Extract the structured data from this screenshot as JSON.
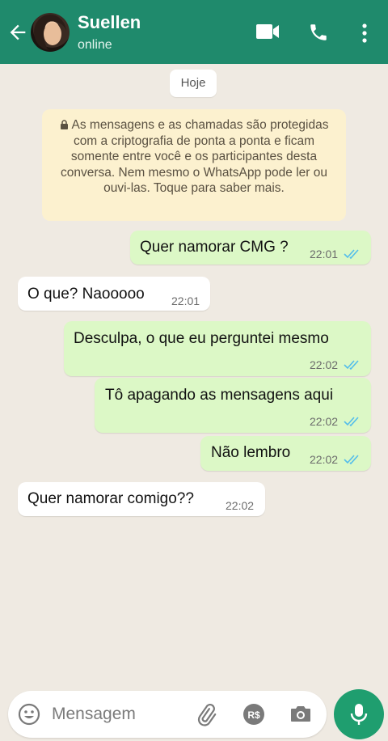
{
  "header": {
    "contact_name": "Suellen",
    "status": "online",
    "icons": [
      "back-arrow-icon",
      "video-call-icon",
      "phone-icon",
      "more-options-icon"
    ],
    "color": "#1f8a6c"
  },
  "chat": {
    "date_label": "Hoje",
    "encryption_notice": "As mensagens e as chamadas são protegidas com a criptografia de ponta a ponta e ficam somente entre você e os participantes desta conversa. Nem mesmo o WhatsApp pode ler ou ouvi-las. Toque para saber mais.",
    "messages": [
      {
        "direction": "out",
        "text": "Quer namorar CMG ?",
        "time": "22:01",
        "read": true
      },
      {
        "direction": "in",
        "text": "O que? Naooooo",
        "time": "22:01"
      },
      {
        "direction": "out",
        "text": "Desculpa, o que eu perguntei mesmo",
        "time": "22:02",
        "read": true
      },
      {
        "direction": "out",
        "text": "Tô apagando as mensagens aqui",
        "time": "22:02",
        "read": true
      },
      {
        "direction": "out",
        "text": "Não lembro",
        "time": "22:02",
        "read": true
      },
      {
        "direction": "in",
        "text": "Quer namorar comigo??",
        "time": "22:02"
      }
    ]
  },
  "input": {
    "placeholder": "Mensagem",
    "icons": [
      "emoji-icon",
      "attach-icon",
      "payment-icon",
      "camera-icon",
      "mic-icon"
    ]
  },
  "colors": {
    "outgoing_bubble": "#dcf8c6",
    "incoming_bubble": "#ffffff",
    "read_ticks": "#53bdeb",
    "background": "#efeae2",
    "notice_bg": "#fcf1cf"
  }
}
